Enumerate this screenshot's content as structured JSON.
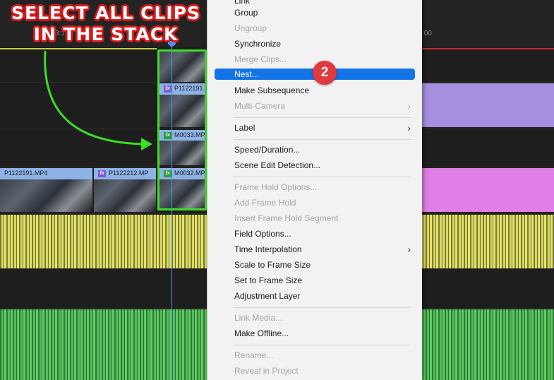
{
  "annotation": {
    "line1": "SELECT ALL CLIPS",
    "line2": "IN THE STACK",
    "step_badge": "2"
  },
  "ruler": {
    "left_time": "3:1",
    "right_time": ":00"
  },
  "clips": {
    "v3_top": "P1122191.",
    "v2_top": "M0033.MP",
    "v1_top": "M0032.MP",
    "v1_a": "P1122191.MP4",
    "v1_b": "P1122212.MP",
    "fx": "fx"
  },
  "menu": {
    "items": [
      {
        "label": "Link",
        "enabled": true
      },
      {
        "label": "Group",
        "enabled": true
      },
      {
        "label": "Ungroup",
        "enabled": false
      },
      {
        "label": "Synchronize",
        "enabled": true
      },
      {
        "label": "Merge Clips...",
        "enabled": false
      },
      {
        "label": "Nest...",
        "enabled": true,
        "highlighted": true
      },
      {
        "label": "Make Subsequence",
        "enabled": true
      },
      {
        "label": "Multi-Camera",
        "enabled": false,
        "submenu": true
      },
      {
        "label": "Label",
        "enabled": true,
        "submenu": true
      },
      {
        "label": "Speed/Duration...",
        "enabled": true
      },
      {
        "label": "Scene Edit Detection...",
        "enabled": true
      },
      {
        "label": "Frame Hold Options...",
        "enabled": false
      },
      {
        "label": "Add Frame Hold",
        "enabled": false
      },
      {
        "label": "Insert Frame Hold Segment",
        "enabled": false
      },
      {
        "label": "Field Options...",
        "enabled": true
      },
      {
        "label": "Time Interpolation",
        "enabled": true,
        "submenu": true
      },
      {
        "label": "Scale to Frame Size",
        "enabled": true
      },
      {
        "label": "Set to Frame Size",
        "enabled": true
      },
      {
        "label": "Adjustment Layer",
        "enabled": true
      },
      {
        "label": "Link Media...",
        "enabled": false
      },
      {
        "label": "Make Offline...",
        "enabled": true
      },
      {
        "label": "Rename...",
        "enabled": false
      },
      {
        "label": "Reveal in Project",
        "enabled": false
      }
    ],
    "submenu_glyph": "›"
  },
  "colors": {
    "highlight": "#1473e6",
    "purple_clip": "#a58fe0",
    "pink_clip": "#e07fe6",
    "blue_clip": "#8db3e6",
    "selection_box": "#3fdc2a",
    "badge": "#e0393e"
  }
}
